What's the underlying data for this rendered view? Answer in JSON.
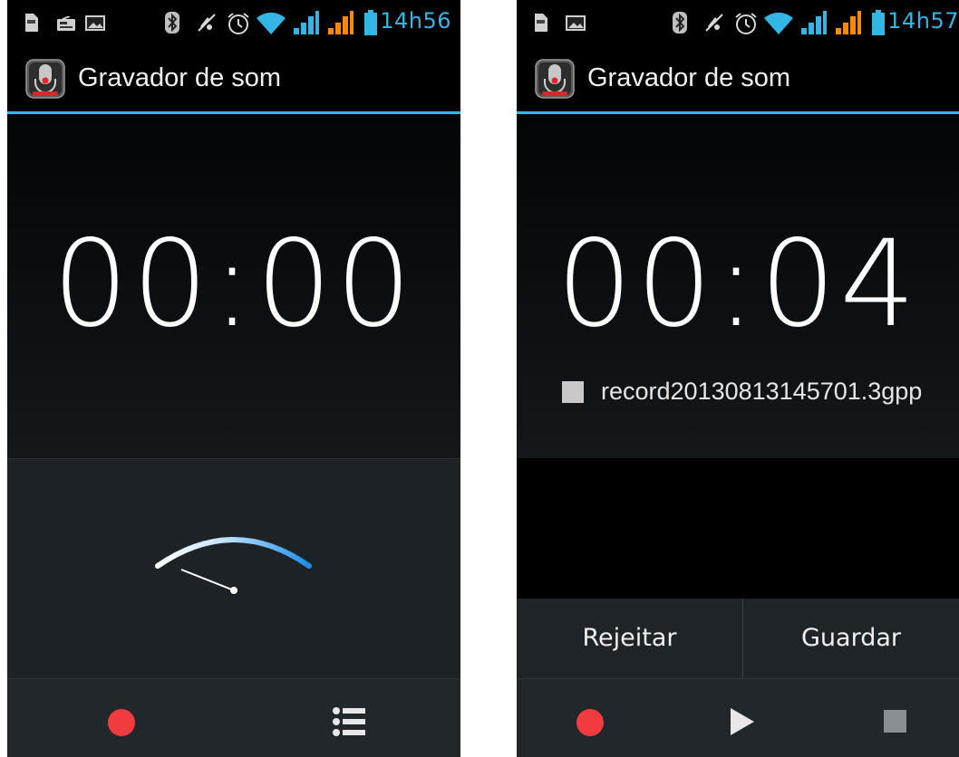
{
  "left_screen": {
    "status_time": "14h56",
    "app_title": "Gravador de som",
    "timer": "00:00"
  },
  "right_screen": {
    "status_time": "14h57",
    "app_title": "Gravador de som",
    "timer": "00:04",
    "file_name": "record20130813145701.3gpp",
    "discard_label": "Rejeitar",
    "save_label": "Guardar"
  },
  "colors": {
    "accent": "#33b5e5",
    "record_red": "#f23b3f",
    "background": "#000000"
  },
  "icons": {
    "status_left": [
      "sd-card-icon",
      "radio-icon",
      "image-icon",
      "bluetooth-icon",
      "mute-icon",
      "alarm-icon",
      "wifi-icon",
      "signal-sim1-icon",
      "signal-sim2-icon",
      "battery-icon"
    ],
    "status_right": [
      "sd-card-icon",
      "image-icon",
      "bluetooth-icon",
      "mute-icon",
      "alarm-icon",
      "wifi-icon",
      "signal-sim1-icon",
      "signal-sim2-icon",
      "battery-icon"
    ],
    "bottom_left": [
      "record-icon",
      "recordings-list-icon"
    ],
    "bottom_right": [
      "record-icon",
      "play-icon",
      "stop-icon"
    ]
  }
}
